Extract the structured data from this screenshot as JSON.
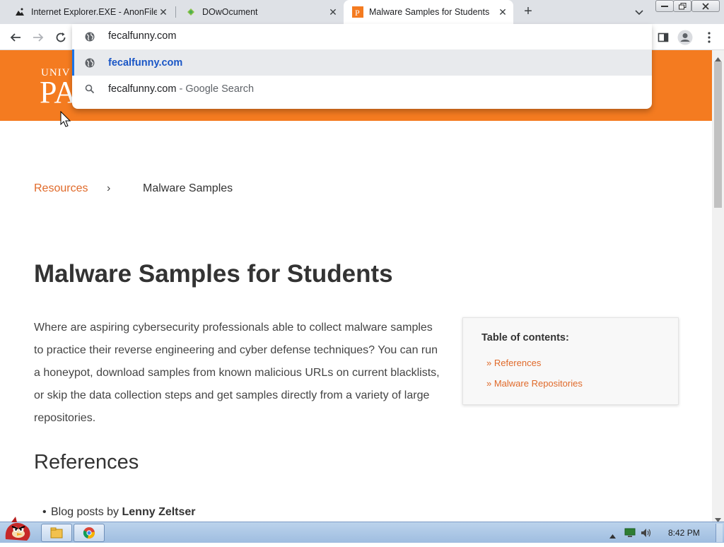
{
  "tabs": [
    {
      "title": "Internet Explorer.EXE - AnonFiles",
      "icon": "anonfiles-icon"
    },
    {
      "title": "DOwOcument",
      "icon": "document-icon"
    },
    {
      "title": "Malware Samples for Students",
      "icon": "p-logo-icon",
      "active": true
    }
  ],
  "toolbar": {
    "address": "fecalfunny.com"
  },
  "omnibox": {
    "suggestions": [
      {
        "text": "fecalfunny.com",
        "suffix": "",
        "icon": "globe-icon"
      },
      {
        "text": "fecalfunny.com",
        "suffix": " - Google Search",
        "icon": "search-icon"
      }
    ]
  },
  "page": {
    "logo_small": "UNIV",
    "logo_big": "PA",
    "breadcrumb": {
      "link": "Resources",
      "separator": "›",
      "current": "Malware Samples"
    },
    "title": "Malware Samples for Students",
    "intro": "Where are aspiring cybersecurity professionals able to collect malware samples to practice their reverse engineering and cyber defense techniques? You can run a honeypot, download samples from known malicious URLs on current blacklists, or skip the data collection steps and get samples directly from a variety of large repositories.",
    "toc": {
      "title": "Table of contents:",
      "items": [
        "» References",
        "» Malware Repositories"
      ]
    },
    "references_heading": "References",
    "blog_item": {
      "prefix": "Blog posts by ",
      "author": "Lenny Zeltser"
    }
  },
  "taskbar": {
    "clock": "8:42 PM"
  },
  "colors": {
    "accent": "#f47b20",
    "link": "#e06a2a",
    "tab_bg": "#dee1e6"
  }
}
